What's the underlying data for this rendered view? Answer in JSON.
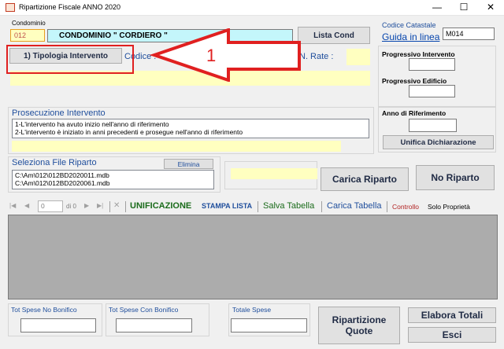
{
  "window": {
    "title": "Ripartizione Fiscale  ANNO 2020",
    "minimize": "—",
    "maximize": "☐",
    "close": "✕"
  },
  "condominio": {
    "label": "Condominio",
    "code": "012",
    "name": "CONDOMINIO \" CORDIERO \"",
    "lista_cond_button": "Lista Cond",
    "codice_label": "Codice :",
    "n_rate_label": "N. Rate :"
  },
  "tipologia_button": "1) Tipologia Intervento",
  "annotation": {
    "number": "1",
    "color": "#e02020"
  },
  "right_panel": {
    "codice_catastale_label": "Codice Catastale",
    "guida_link": "Guida in linea",
    "codice_catastale_value": "M014",
    "progressivo_intervento_label": "Progressivo Intervento",
    "progressivo_edificio_label": "Progressivo Edificio",
    "anno_riferimento_label": "Anno di Riferimento",
    "unifica_button": "Unifica Dichiarazione"
  },
  "prosecuzione": {
    "title": "Prosecuzione Intervento",
    "options": [
      "1-L'intervento ha avuto inizio nell'anno di riferimento",
      "2-L'intervento è iniziato in anni precedenti e prosegue nell'anno di riferimento"
    ]
  },
  "file_riparto": {
    "title": "Seleziona File Riparto",
    "elimina_button": "Elimina",
    "files": [
      "C:\\Am\\012\\012BD2020011.mdb",
      "C:\\Am\\012\\012BD2020061.mdb"
    ]
  },
  "carica_riparto_button": "Carica Riparto",
  "no_riparto_button": "No Riparto",
  "toolbar": {
    "first": "|◀",
    "prev": "◀",
    "position": "0",
    "of_label": "di 0",
    "next": "▶",
    "last": "▶|",
    "delete": "✕",
    "unificazione": "UNIFICAZIONE",
    "stampa_lista": "STAMPA LISTA",
    "salva_tabella": "Salva Tabella",
    "carica_tabella": "Carica Tabella",
    "controllo": "Controllo",
    "solo_proprieta": "Solo Proprietà"
  },
  "totals": {
    "no_bonifico_label": "Tot Spese No Bonifico",
    "con_bonifico_label": "Tot Spese Con Bonifico",
    "totale_label": "Totale Spese",
    "ripartizione_button": "Ripartizione\nQuote",
    "ripartizione_line1": "Ripartizione",
    "ripartizione_line2": "Quote",
    "elabora_button": "Elabora Totali",
    "esci_button": "Esci"
  }
}
